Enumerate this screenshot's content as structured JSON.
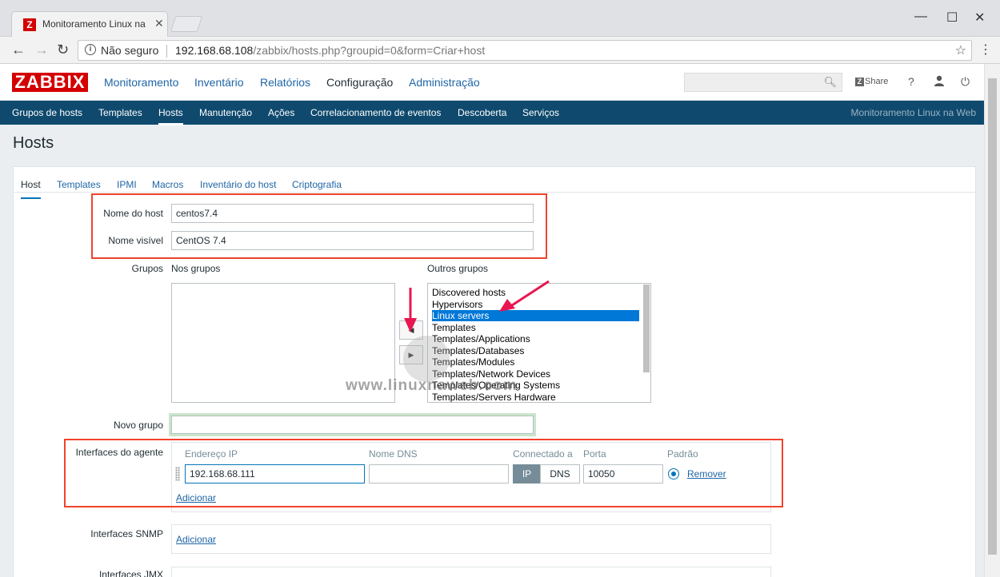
{
  "browser": {
    "tab_title": "Monitoramento Linux na",
    "favicon_letter": "Z",
    "security": "Não seguro",
    "url_host": "192.168.68.108",
    "url_path": "/zabbix/hosts.php?groupid=0&form=Criar+host"
  },
  "header": {
    "logo": "ZABBIX",
    "nav": [
      "Monitoramento",
      "Inventário",
      "Relatórios",
      "Configuração",
      "Administração"
    ],
    "share_label": "Share",
    "help": "?"
  },
  "subnav": {
    "items": [
      "Grupos de hosts",
      "Templates",
      "Hosts",
      "Manutenção",
      "Ações",
      "Correlacionamento de eventos",
      "Descoberta",
      "Serviços"
    ],
    "right_text": "Monitoramento Linux na Web"
  },
  "page_title": "Hosts",
  "form_tabs": [
    "Host",
    "Templates",
    "IPMI",
    "Macros",
    "Inventário do host",
    "Criptografia"
  ],
  "form": {
    "host_name_label": "Nome do host",
    "host_name_value": "centos7.4",
    "visible_name_label": "Nome visível",
    "visible_name_value": "CentOS 7.4",
    "groups_label": "Grupos",
    "in_groups_label": "Nos grupos",
    "other_groups_label": "Outros grupos",
    "other_groups": [
      "Discovered hosts",
      "Hypervisors",
      "Linux servers",
      "Templates",
      "Templates/Applications",
      "Templates/Databases",
      "Templates/Modules",
      "Templates/Network Devices",
      "Templates/Operating Systems",
      "Templates/Servers Hardware"
    ],
    "selected_group": "Linux servers",
    "new_group_label": "Novo grupo",
    "agent_interfaces_label": "Interfaces do agente",
    "col_ip": "Endereço IP",
    "col_dns": "Nome DNS",
    "col_connect": "Connectado a",
    "col_port": "Porta",
    "col_default": "Padrão",
    "ip_value": "192.168.68.111",
    "dns_value": "",
    "connect_ip": "IP",
    "connect_dns": "DNS",
    "port_value": "10050",
    "remove_label": "Remover",
    "add_label": "Adicionar",
    "snmp_label": "Interfaces SNMP",
    "snmp_add_label": "Adicionar",
    "jmx_label": "Interfaces JMX"
  },
  "watermark": "www.linuxnaweb.com",
  "colors": {
    "brand_red": "#d40000",
    "subnav_bg": "#0f4a6e",
    "link_blue": "#1f65a6",
    "highlight_red": "#f0432c",
    "selection_blue": "#0078d7",
    "arrow_pink": "#e8174f"
  }
}
